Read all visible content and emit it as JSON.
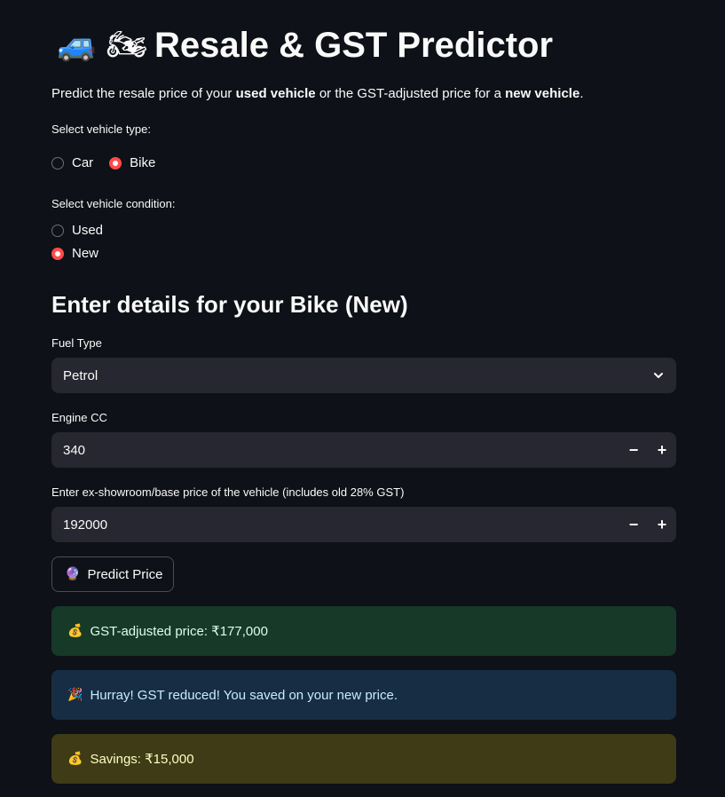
{
  "header": {
    "title_icons": "🚙 🏍",
    "title": "Resale & GST Predictor",
    "intro_prefix": "Predict the resale price of your ",
    "intro_bold1": "used vehicle",
    "intro_mid": " or the GST-adjusted price for a ",
    "intro_bold2": "new vehicle",
    "intro_suffix": "."
  },
  "vehicle_type": {
    "label": "Select vehicle type:",
    "options": [
      "Car",
      "Bike"
    ],
    "selected": "Bike"
  },
  "vehicle_condition": {
    "label": "Select vehicle condition:",
    "options": [
      "Used",
      "New"
    ],
    "selected": "New"
  },
  "section": {
    "title": "Enter details for your Bike (New)"
  },
  "fuel_type": {
    "label": "Fuel Type",
    "value": "Petrol"
  },
  "engine_cc": {
    "label": "Engine CC",
    "value": "340",
    "minus": "−",
    "plus": "+"
  },
  "base_price": {
    "label": "Enter ex-showroom/base price of the vehicle (includes old 28% GST)",
    "value": "192000",
    "minus": "−",
    "plus": "+"
  },
  "predict_button": {
    "icon": "🔮",
    "label": "Predict Price"
  },
  "results": {
    "gst_icon": "💰",
    "gst_text": "GST-adjusted price: ₹177,000",
    "info_icon": "🎉",
    "info_text": "Hurray! GST reduced! You saved on your new price.",
    "savings_icon": "💰",
    "savings_text": "Savings: ₹15,000"
  },
  "colors": {
    "background": "#0e1117",
    "accent": "#ff4b4b",
    "input_bg": "#262730",
    "success_bg": "#173928",
    "info_bg": "#172d43",
    "warning_bg": "#3e3b16"
  }
}
